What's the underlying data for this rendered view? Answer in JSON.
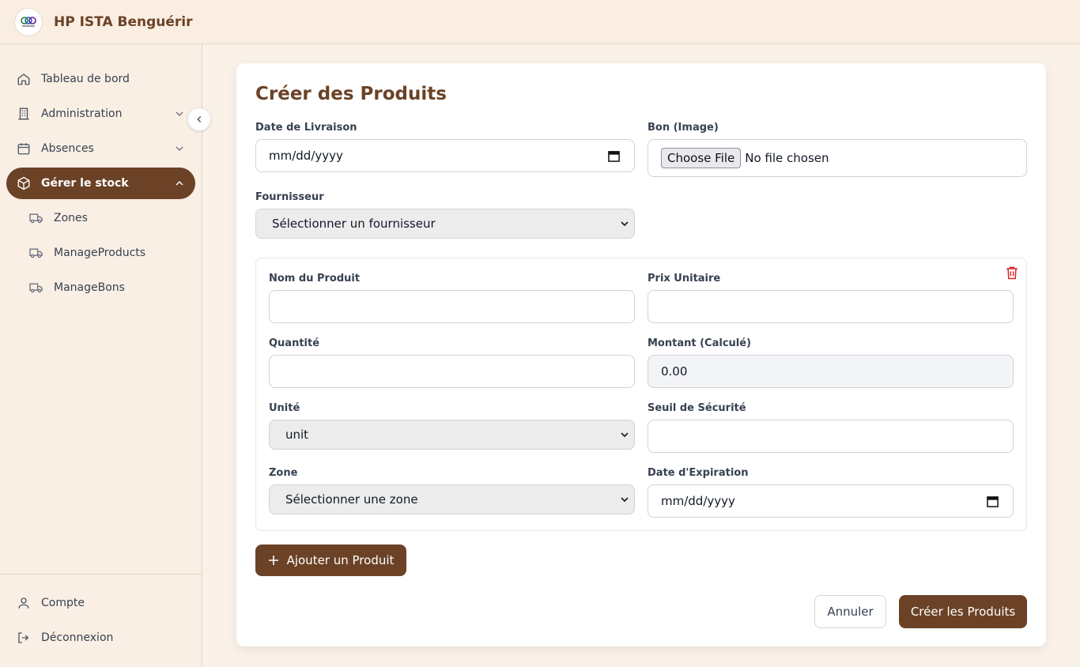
{
  "app": {
    "brand": "HP ISTA Benguérir",
    "logo_text": "ISTA"
  },
  "sidebar": {
    "items": [
      {
        "label": "Tableau de bord",
        "icon": "home-icon"
      },
      {
        "label": "Administration",
        "icon": "building-icon"
      },
      {
        "label": "Absences",
        "icon": "calendar-icon"
      },
      {
        "label": "Gérer le stock",
        "icon": "box-icon"
      }
    ],
    "sub_items": [
      {
        "label": "Zones",
        "icon": "truck-icon"
      },
      {
        "label": "ManageProducts",
        "icon": "truck-icon"
      },
      {
        "label": "ManageBons",
        "icon": "truck-icon"
      }
    ],
    "bottom": [
      {
        "label": "Compte",
        "icon": "user-icon"
      },
      {
        "label": "Déconnexion",
        "icon": "logout-icon"
      }
    ]
  },
  "form": {
    "title": "Créer des Produits",
    "delivery_date": {
      "label": "Date de Livraison",
      "value": "mm/dd/yyyy"
    },
    "bon_image": {
      "label": "Bon (Image)",
      "button": "Choose File",
      "status": "No file chosen"
    },
    "supplier": {
      "label": "Fournisseur",
      "value": "Sélectionner un fournisseur"
    },
    "product": {
      "name_label": "Nom du Produit",
      "price_label": "Prix Unitaire",
      "qty_label": "Quantité",
      "amount_label": "Montant (Calculé)",
      "amount_value": "0.00",
      "unit_label": "Unité",
      "unit_value": "unit",
      "threshold_label": "Seuil de Sécurité",
      "zone_label": "Zone",
      "zone_value": "Sélectionner une zone",
      "expiry_label": "Date d'Expiration",
      "expiry_value": "mm/dd/yyyy"
    },
    "add_product": "Ajouter un Produit",
    "cancel": "Annuler",
    "submit": "Créer les Produits"
  }
}
